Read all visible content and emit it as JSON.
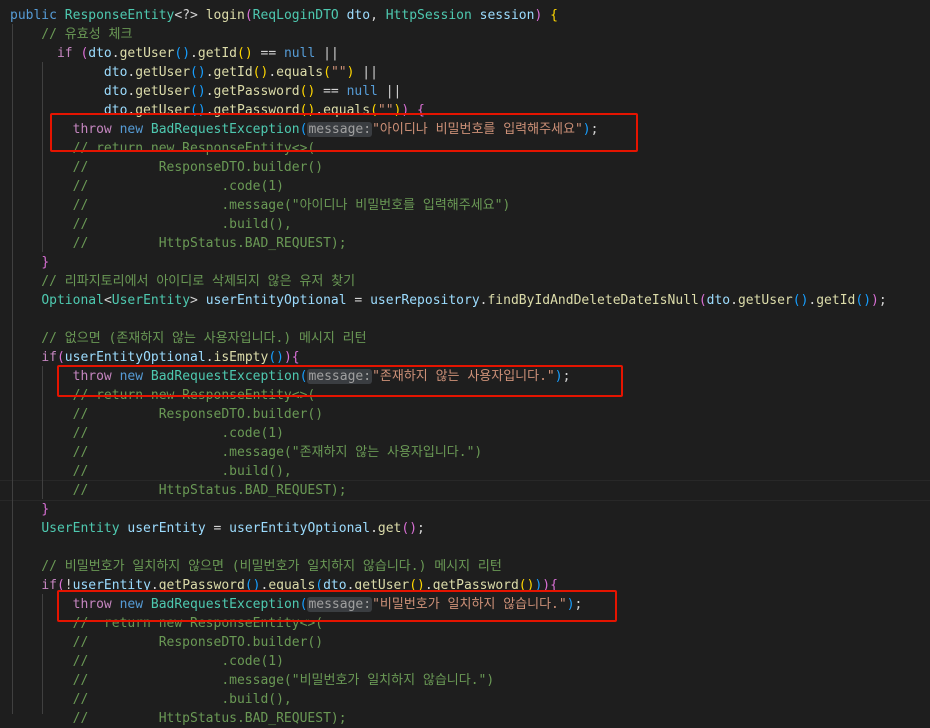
{
  "lines": [
    [
      [
        "public ",
        "keyword"
      ],
      [
        "ResponseEntity",
        "type"
      ],
      [
        "<?> ",
        "punct"
      ],
      [
        "login",
        "func"
      ],
      [
        "(",
        "brace2"
      ],
      [
        "ReqLoginDTO ",
        "type"
      ],
      [
        "dto",
        "var"
      ],
      [
        ", ",
        "punct"
      ],
      [
        "HttpSession ",
        "type"
      ],
      [
        "session",
        "var"
      ],
      [
        ") ",
        "brace2"
      ],
      [
        "{",
        "brace1"
      ]
    ],
    [
      [
        "    // 유효성 체크",
        "comment"
      ]
    ],
    [
      [
        "      ",
        "punct"
      ],
      [
        "if ",
        "control"
      ],
      [
        "(",
        "brace2"
      ],
      [
        "dto",
        "var"
      ],
      [
        ".",
        "punct"
      ],
      [
        "getUser",
        "func"
      ],
      [
        "(",
        "brace3"
      ],
      [
        ")",
        "brace3"
      ],
      [
        ".",
        "punct"
      ],
      [
        "getId",
        "func"
      ],
      [
        "(",
        "brace1"
      ],
      [
        ")",
        "brace1"
      ],
      [
        " == ",
        "punct"
      ],
      [
        "null",
        "keyword"
      ],
      [
        " ||",
        "punct"
      ]
    ],
    [
      [
        "            ",
        "punct"
      ],
      [
        "dto",
        "var"
      ],
      [
        ".",
        "punct"
      ],
      [
        "getUser",
        "func"
      ],
      [
        "(",
        "brace3"
      ],
      [
        ")",
        "brace3"
      ],
      [
        ".",
        "punct"
      ],
      [
        "getId",
        "func"
      ],
      [
        "(",
        "brace1"
      ],
      [
        ")",
        "brace1"
      ],
      [
        ".",
        "punct"
      ],
      [
        "equals",
        "func"
      ],
      [
        "(",
        "brace1"
      ],
      [
        "\"\"",
        "string"
      ],
      [
        ")",
        "brace1"
      ],
      [
        " ||",
        "punct"
      ]
    ],
    [
      [
        "            ",
        "punct"
      ],
      [
        "dto",
        "var"
      ],
      [
        ".",
        "punct"
      ],
      [
        "getUser",
        "func"
      ],
      [
        "(",
        "brace3"
      ],
      [
        ")",
        "brace3"
      ],
      [
        ".",
        "punct"
      ],
      [
        "getPassword",
        "func"
      ],
      [
        "(",
        "brace1"
      ],
      [
        ")",
        "brace1"
      ],
      [
        " == ",
        "punct"
      ],
      [
        "null",
        "keyword"
      ],
      [
        " ||",
        "punct"
      ]
    ],
    [
      [
        "            ",
        "punct"
      ],
      [
        "dto",
        "var"
      ],
      [
        ".",
        "punct"
      ],
      [
        "getUser",
        "func"
      ],
      [
        "(",
        "brace3"
      ],
      [
        ")",
        "brace3"
      ],
      [
        ".",
        "punct"
      ],
      [
        "getPassword",
        "func"
      ],
      [
        "(",
        "brace1"
      ],
      [
        ")",
        "brace1"
      ],
      [
        ".",
        "punct"
      ],
      [
        "equals",
        "func"
      ],
      [
        "(",
        "brace1"
      ],
      [
        "\"\"",
        "string"
      ],
      [
        ")",
        "brace1"
      ],
      [
        ")",
        "brace2"
      ],
      [
        " ",
        "punct"
      ],
      [
        "{",
        "brace2"
      ]
    ],
    [
      [
        "        ",
        "punct"
      ],
      [
        "throw ",
        "control"
      ],
      [
        "new ",
        "keyword"
      ],
      [
        "BadRequestException",
        "type"
      ],
      [
        "(",
        "brace3"
      ],
      [
        "message:",
        "hint"
      ],
      [
        "\"아이디나 비밀번호를 입력해주세요\"",
        "string"
      ],
      [
        ")",
        "brace3"
      ],
      [
        ";",
        "punct"
      ]
    ],
    [
      [
        "        // return new ResponseEntity<>(",
        "comment"
      ]
    ],
    [
      [
        "        //         ResponseDTO.builder()",
        "comment"
      ]
    ],
    [
      [
        "        //                 .code(1)",
        "comment"
      ]
    ],
    [
      [
        "        //                 .message(\"아이디나 비밀번호를 입력해주세요\")",
        "comment"
      ]
    ],
    [
      [
        "        //                 .build(),",
        "comment"
      ]
    ],
    [
      [
        "        //         HttpStatus.BAD_REQUEST);",
        "comment"
      ]
    ],
    [
      [
        "    ",
        "punct"
      ],
      [
        "}",
        "brace2"
      ]
    ],
    [
      [
        "    // 리파지토리에서 아이디로 삭제되지 않은 유저 찾기",
        "comment"
      ]
    ],
    [
      [
        "    ",
        "punct"
      ],
      [
        "Optional",
        "type"
      ],
      [
        "<",
        "punct"
      ],
      [
        "UserEntity",
        "type"
      ],
      [
        "> ",
        "punct"
      ],
      [
        "userEntityOptional",
        "var"
      ],
      [
        " = ",
        "punct"
      ],
      [
        "userRepository",
        "var"
      ],
      [
        ".",
        "punct"
      ],
      [
        "findByIdAndDeleteDateIsNull",
        "func"
      ],
      [
        "(",
        "brace2"
      ],
      [
        "dto",
        "var"
      ],
      [
        ".",
        "punct"
      ],
      [
        "getUser",
        "func"
      ],
      [
        "(",
        "brace3"
      ],
      [
        ")",
        "brace3"
      ],
      [
        ".",
        "punct"
      ],
      [
        "getId",
        "func"
      ],
      [
        "(",
        "brace3"
      ],
      [
        ")",
        "brace3"
      ],
      [
        ")",
        "brace2"
      ],
      [
        ";",
        "punct"
      ]
    ],
    [],
    [
      [
        "    // 없으면 (존재하지 않는 사용자입니다.) 메시지 리턴",
        "comment"
      ]
    ],
    [
      [
        "    ",
        "punct"
      ],
      [
        "if",
        "control"
      ],
      [
        "(",
        "brace2"
      ],
      [
        "userEntityOptional",
        "var"
      ],
      [
        ".",
        "punct"
      ],
      [
        "isEmpty",
        "func"
      ],
      [
        "(",
        "brace3"
      ],
      [
        ")",
        "brace3"
      ],
      [
        ")",
        "brace2"
      ],
      [
        "{",
        "brace2"
      ]
    ],
    [
      [
        "        ",
        "punct"
      ],
      [
        "throw ",
        "control"
      ],
      [
        "new ",
        "keyword"
      ],
      [
        "BadRequestException",
        "type"
      ],
      [
        "(",
        "brace3"
      ],
      [
        "message:",
        "hint"
      ],
      [
        "\"존재하지 않는 사용자입니다.\"",
        "string"
      ],
      [
        ")",
        "brace3"
      ],
      [
        ";",
        "punct"
      ]
    ],
    [
      [
        "        // return new ResponseEntity<>(",
        "comment"
      ]
    ],
    [
      [
        "        //         ResponseDTO.builder()",
        "comment"
      ]
    ],
    [
      [
        "        //                 .code(1)",
        "comment"
      ]
    ],
    [
      [
        "        //                 .message(\"존재하지 않는 사용자입니다.\")",
        "comment"
      ]
    ],
    [
      [
        "        //                 .build(),",
        "comment"
      ]
    ],
    [
      [
        "        //         HttpStatus.BAD_REQUEST);",
        "comment"
      ]
    ],
    [
      [
        "    ",
        "punct"
      ],
      [
        "}",
        "brace2"
      ]
    ],
    [
      [
        "    ",
        "punct"
      ],
      [
        "UserEntity ",
        "type"
      ],
      [
        "userEntity",
        "var"
      ],
      [
        " = ",
        "punct"
      ],
      [
        "userEntityOptional",
        "var"
      ],
      [
        ".",
        "punct"
      ],
      [
        "get",
        "func"
      ],
      [
        "(",
        "brace2"
      ],
      [
        ")",
        "brace2"
      ],
      [
        ";",
        "punct"
      ]
    ],
    [],
    [
      [
        "    // 비밀번호가 일치하지 않으면 (비밀번호가 일치하지 않습니다.) 메시지 리턴",
        "comment"
      ]
    ],
    [
      [
        "    ",
        "punct"
      ],
      [
        "if",
        "control"
      ],
      [
        "(",
        "brace2"
      ],
      [
        "!",
        "punct"
      ],
      [
        "userEntity",
        "var"
      ],
      [
        ".",
        "punct"
      ],
      [
        "getPassword",
        "func"
      ],
      [
        "(",
        "brace3"
      ],
      [
        ")",
        "brace3"
      ],
      [
        ".",
        "punct"
      ],
      [
        "equals",
        "func"
      ],
      [
        "(",
        "brace3"
      ],
      [
        "dto",
        "var"
      ],
      [
        ".",
        "punct"
      ],
      [
        "getUser",
        "func"
      ],
      [
        "(",
        "brace1"
      ],
      [
        ")",
        "brace1"
      ],
      [
        ".",
        "punct"
      ],
      [
        "getPassword",
        "func"
      ],
      [
        "(",
        "brace1"
      ],
      [
        ")",
        "brace1"
      ],
      [
        ")",
        "brace3"
      ],
      [
        ")",
        "brace2"
      ],
      [
        "{",
        "brace2"
      ]
    ],
    [
      [
        "        ",
        "punct"
      ],
      [
        "throw ",
        "control"
      ],
      [
        "new ",
        "keyword"
      ],
      [
        "BadRequestException",
        "type"
      ],
      [
        "(",
        "brace3"
      ],
      [
        "message:",
        "hint"
      ],
      [
        "\"비밀번호가 일치하지 않습니다.\"",
        "string"
      ],
      [
        ")",
        "brace3"
      ],
      [
        ";",
        "punct"
      ]
    ],
    [
      [
        "        //  return new ResponseEntity<>(",
        "comment"
      ]
    ],
    [
      [
        "        //         ResponseDTO.builder()",
        "comment"
      ]
    ],
    [
      [
        "        //                 .code(1)",
        "comment"
      ]
    ],
    [
      [
        "        //                 .message(\"비밀번호가 일치하지 않습니다.\")",
        "comment"
      ]
    ],
    [
      [
        "        //                 .build(),",
        "comment"
      ]
    ],
    [
      [
        "        //         HttpStatus.BAD_REQUEST);",
        "comment"
      ]
    ]
  ],
  "highlight_color": "#e51400"
}
